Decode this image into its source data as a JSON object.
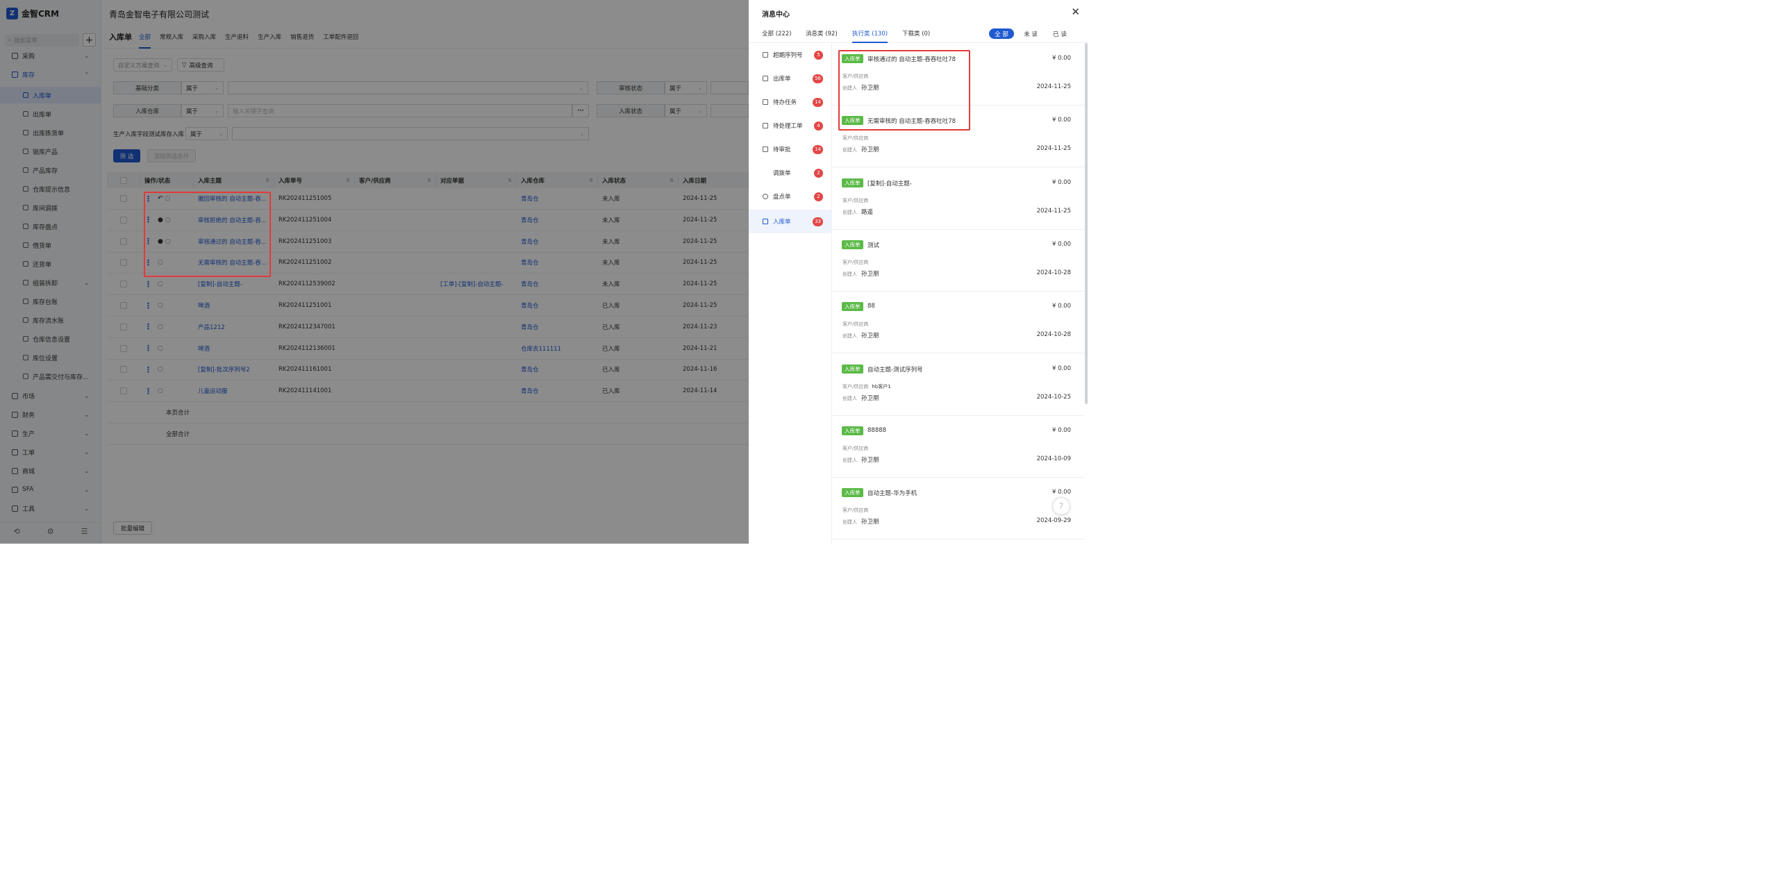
{
  "app": {
    "logo_mark": "Z",
    "name": "金智CRM"
  },
  "sidebar": {
    "search_placeholder": "搜索菜单",
    "add": "+",
    "groups": [
      {
        "label": "采购"
      },
      {
        "label": "库存"
      },
      {
        "label": "市场"
      },
      {
        "label": "财务"
      },
      {
        "label": "生产"
      },
      {
        "label": "工单"
      },
      {
        "label": "商城"
      },
      {
        "label": "SFA"
      },
      {
        "label": "工具"
      }
    ],
    "stock_items": [
      "入库单",
      "出库单",
      "出库拣货单",
      "锁库产品",
      "产品库存",
      "仓库提示信息",
      "库间调拨",
      "库存盘点",
      "借货单",
      "还货单",
      "组装拆卸",
      "库存台账",
      "库存流水账",
      "仓库信息设置",
      "库位设置",
      "产品需交付与库存..."
    ],
    "bottom_icons": [
      "history-icon",
      "settings-icon",
      "menu-collapse-icon"
    ]
  },
  "header": {
    "company": "青岛金智电子有限公司测试"
  },
  "tabbar": {
    "title": "入库单",
    "tabs": [
      "全部",
      "常规入库",
      "采购入库",
      "生产退料",
      "生产入库",
      "销售退货",
      "工单配件退回"
    ]
  },
  "filters": {
    "custom_query": "自定义方案查询",
    "advanced": "高级查询",
    "f1_label": "基础分类",
    "f1_op": "属于",
    "f2_label": "审核状态",
    "f2_op": "属于",
    "f3_label": "入库仓库",
    "f3_op": "属于",
    "f3_placeholder": "输入关键字查询",
    "f3_more": "···",
    "f4_label": "入库状态",
    "f4_op": "属于",
    "f5_label": "生产入库字段测试库存入库",
    "f5_op": "属于",
    "filter_btn": "筛 选",
    "clear_btn": "清除筛选条件"
  },
  "table": {
    "headers": [
      "操作/状态",
      "入库主题",
      "入库单号",
      "客户/供应商",
      "对应单据",
      "入库仓库",
      "入库状态",
      "入库日期"
    ],
    "rows": [
      {
        "icons": "↶ ◌",
        "subject": "撤回审核的 自动主题-吞...",
        "no": "RK202411251005",
        "cust": "",
        "ref": "",
        "wh": "青岛仓",
        "status": "未入库",
        "date": "2024-11-25"
      },
      {
        "icons": "● ◌",
        "subject": "审核拒绝的 自动主题-吞...",
        "no": "RK202411251004",
        "cust": "",
        "ref": "",
        "wh": "青岛仓",
        "status": "未入库",
        "date": "2024-11-25"
      },
      {
        "icons": "● ◌",
        "subject": "审核通过的 自动主题-吞...",
        "no": "RK202411251003",
        "cust": "",
        "ref": "",
        "wh": "青岛仓",
        "status": "未入库",
        "date": "2024-11-25"
      },
      {
        "icons": "◌",
        "subject": "无需审核的 自动主题-吞...",
        "no": "RK202411251002",
        "cust": "",
        "ref": "",
        "wh": "青岛仓",
        "status": "未入库",
        "date": "2024-11-25"
      },
      {
        "icons": "◌",
        "subject": "[复制]-自动主题-",
        "no": "RK2024112539002",
        "cust": "",
        "ref": "[工单]-[复制]-自动主题-",
        "wh": "青岛仓",
        "status": "未入库",
        "date": "2024-11-25"
      },
      {
        "icons": "◌",
        "subject": "啤酒",
        "no": "RK202411251001",
        "cust": "",
        "ref": "",
        "wh": "青岛仓",
        "status": "已入库",
        "date": "2024-11-25"
      },
      {
        "icons": "◌",
        "subject": "产品1212",
        "no": "RK2024112347001",
        "cust": "",
        "ref": "",
        "wh": "青岛仓",
        "status": "已入库",
        "date": "2024-11-23"
      },
      {
        "icons": "◌",
        "subject": "啤酒",
        "no": "RK2024112136001",
        "cust": "",
        "ref": "",
        "wh": "仓库去111111",
        "status": "已入库",
        "date": "2024-11-21"
      },
      {
        "icons": "◌",
        "subject": "[复制]-批次序列号2",
        "no": "RK202411161001",
        "cust": "",
        "ref": "",
        "wh": "青岛仓",
        "status": "已入库",
        "date": "2024-11-16"
      },
      {
        "icons": "◌",
        "subject": "儿童运动服",
        "no": "RK202411141001",
        "cust": "",
        "ref": "",
        "wh": "青岛仓",
        "status": "已入库",
        "date": "2024-11-14"
      }
    ],
    "page_total": "本页合计",
    "all_total": "全部合计"
  },
  "batch_edit": "批量编辑",
  "panel": {
    "title": "消息中心",
    "close": "✕",
    "tabs": [
      "全部 (222)",
      "消息类 (92)",
      "执行类 (130)",
      "下载类 (0)"
    ],
    "segments": [
      "全 部",
      "未 读",
      "已 读"
    ],
    "categories": [
      {
        "label": "超期序列号",
        "badge": "5"
      },
      {
        "label": "出库单",
        "badge": "56"
      },
      {
        "label": "待办任务",
        "badge": "14"
      },
      {
        "label": "待处理工单",
        "badge": "4"
      },
      {
        "label": "待审批",
        "badge": "14"
      },
      {
        "label": "调拨单",
        "badge": "2"
      },
      {
        "label": "盘点单",
        "badge": "2"
      },
      {
        "label": "入库单",
        "badge": "33"
      }
    ],
    "cust_label": "客户/供应商",
    "creator_label": "创建人",
    "messages": [
      {
        "tag": "入库单",
        "title": "审核通过的 自动主题-吞吞吐吐78",
        "amount": "¥ 0.00",
        "cust": "",
        "creator": "孙卫朋",
        "date": "2024-11-25"
      },
      {
        "tag": "入库单",
        "title": "无需审核的 自动主题-吞吞吐吐78",
        "amount": "¥ 0.00",
        "cust": "",
        "creator": "孙卫朋",
        "date": "2024-11-25"
      },
      {
        "tag": "入库单",
        "title": "[复制]-自动主题-",
        "amount": "¥ 0.00",
        "cust": "",
        "creator": "路遥",
        "date": "2024-11-25"
      },
      {
        "tag": "入库单",
        "title": "测试",
        "amount": "¥ 0.00",
        "cust": "",
        "creator": "孙卫朋",
        "date": "2024-10-28"
      },
      {
        "tag": "入库单",
        "title": "88",
        "amount": "¥ 0.00",
        "cust": "",
        "creator": "孙卫朋",
        "date": "2024-10-28"
      },
      {
        "tag": "入库单",
        "title": "自动主题-测试序列号",
        "amount": "¥ 0.00",
        "cust": "hb客户1",
        "creator": "孙卫朋",
        "date": "2024-10-25"
      },
      {
        "tag": "入库单",
        "title": "88888",
        "amount": "¥ 0.00",
        "cust": "",
        "creator": "孙卫朋",
        "date": "2024-10-09"
      },
      {
        "tag": "入库单",
        "title": "自动主题-华为手机",
        "amount": "¥ 0.00",
        "cust": "",
        "creator": "孙卫朋",
        "date": "2024-09-29"
      }
    ],
    "help": "?"
  },
  "colors": {
    "accent": "#1f5ad1",
    "badge": "#e34747",
    "tag": "#5cba48",
    "highlight": "#e23a3a"
  }
}
